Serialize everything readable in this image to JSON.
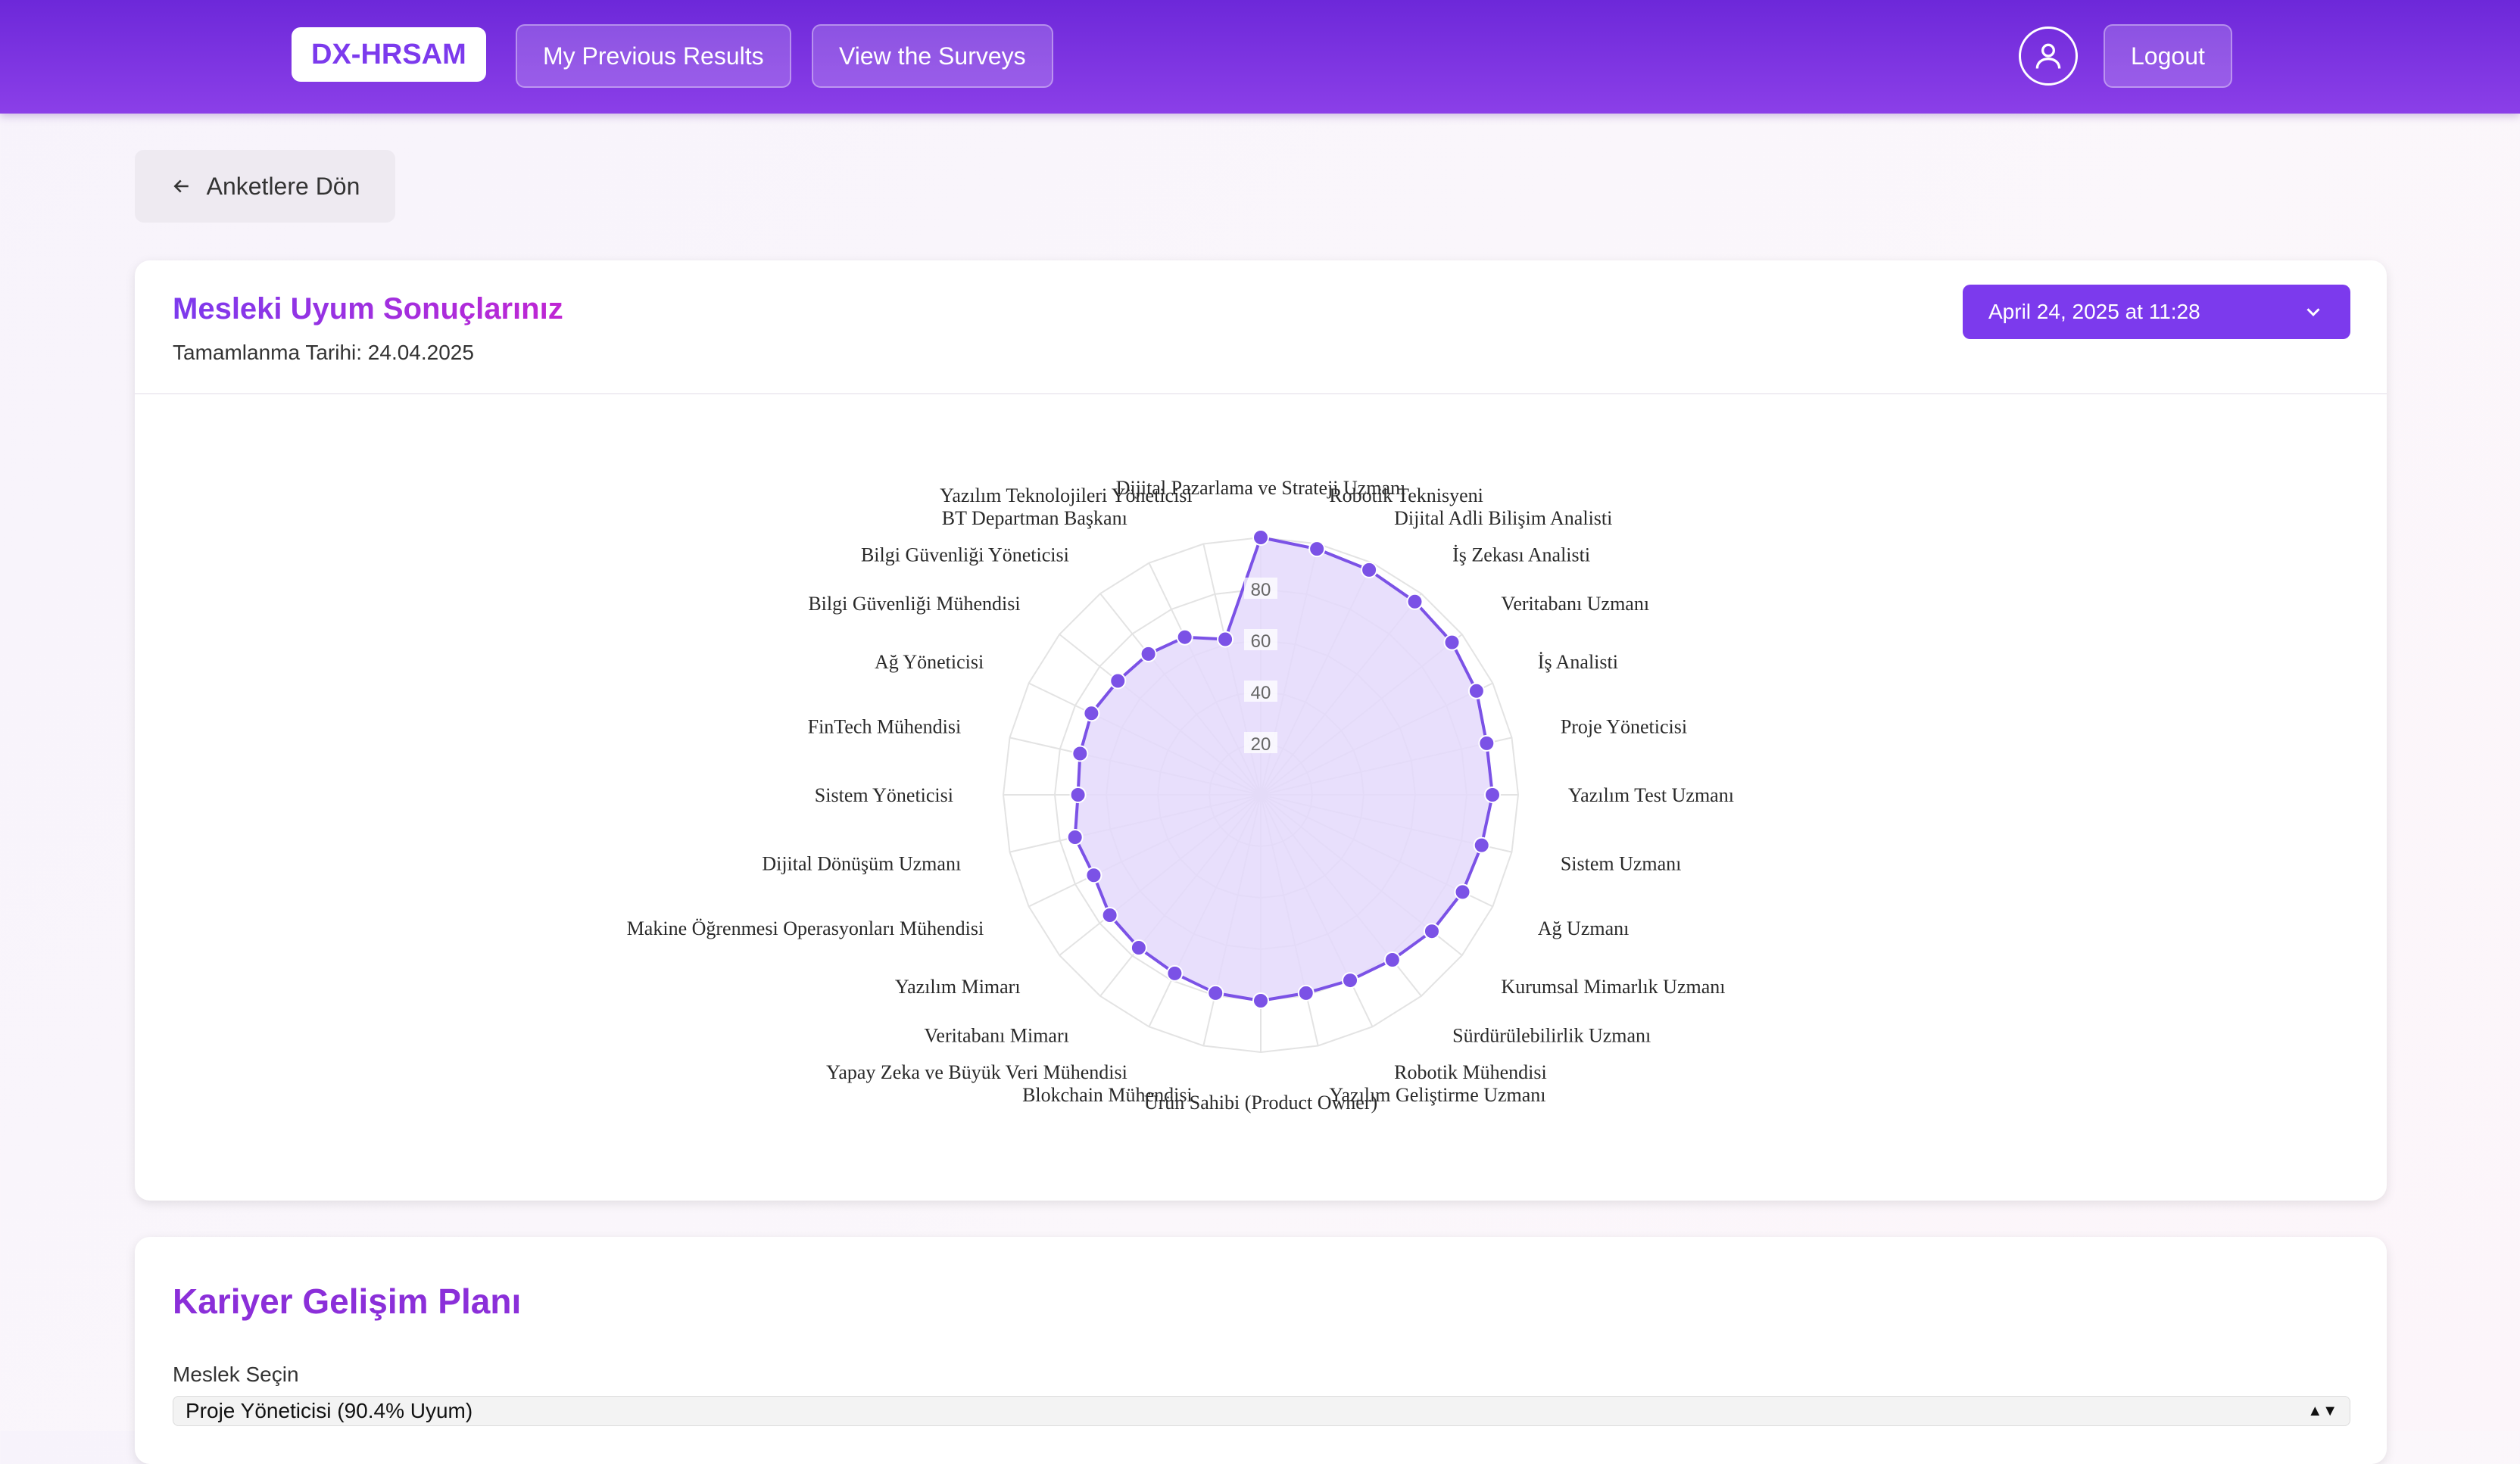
{
  "nav": {
    "brand": "DX-HRSAM",
    "previous_results": "My Previous Results",
    "view_surveys": "View the Surveys",
    "logout": "Logout"
  },
  "back_label": "Anketlere Dön",
  "results": {
    "title": "Mesleki Uyum Sonuçlarınız",
    "completion": "Tamamlanma Tarihi: 24.04.2025",
    "selected_date": "April 24, 2025 at 11:28"
  },
  "career": {
    "title": "Kariyer Gelişim Planı",
    "select_label": "Meslek Seçin",
    "selected_option": "Proje Yöneticisi (90.4% Uyum)"
  },
  "colors": {
    "accent": "#7c3aed",
    "fill": "#e4d9fb",
    "point": "#7b52e6"
  },
  "chart_data": {
    "type": "radar",
    "r_ticks": [
      20,
      40,
      60,
      80
    ],
    "rlim": [
      0,
      100
    ],
    "categories": [
      "Dijital Pazarlama ve Strateji Uzmanı",
      "Robotik Teknisyeni",
      "Dijital Adli Bilişim Analisti",
      "İş Zekası Analisti",
      "Veritabanı Uzmanı",
      "İş Analisti",
      "Proje Yöneticisi",
      "Yazılım Test Uzmanı",
      "Sistem Uzmanı",
      "Ağ Uzmanı",
      "Kurumsal Mimarlık Uzmanı",
      "Sürdürülebilirlik Uzmanı",
      "Robotik Mühendisi",
      "Yazılım Geliştirme Uzmanı",
      "Ürün Sahibi (Product Owner)",
      "Blokchain Mühendisi",
      "Yapay Zeka ve Büyük Veri Mühendisi",
      "Veritabanı Mimarı",
      "Yazılım Mimarı",
      "Makine Öğrenmesi Operasyonları Mühendisi",
      "Dijital Dönüşüm Uzmanı",
      "Sistem Yöneticisi",
      "FinTech Mühendisi",
      "Ağ Yöneticisi",
      "Bilgi Güvenliği Mühendisi",
      "Bilgi Güvenliği Yöneticisi",
      "BT Departman Başkanı",
      "Yazılım Teknolojileri Yöneticisi"
    ],
    "values": [
      100,
      98,
      97,
      96,
      95,
      93,
      90,
      90,
      88,
      87,
      85,
      82,
      80,
      79,
      80,
      79,
      77,
      76,
      75,
      72,
      74,
      71,
      72,
      73,
      71,
      70,
      68,
      62
    ]
  }
}
